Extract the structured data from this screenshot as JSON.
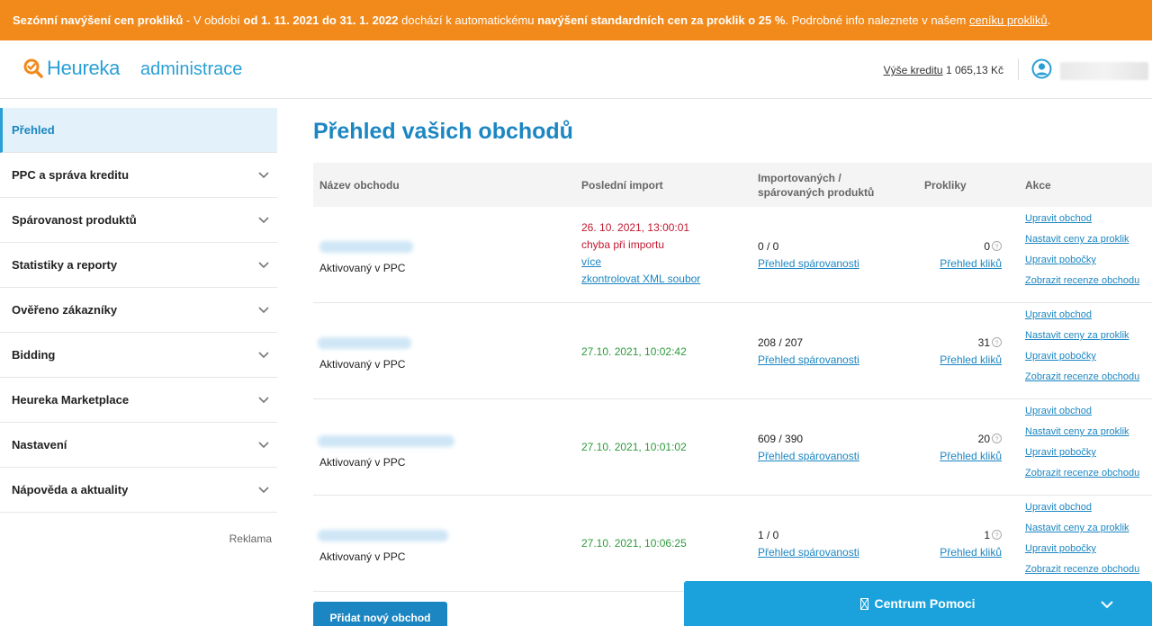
{
  "banner": {
    "part1": "Sezónní navýšení cen prokliků",
    "part2": " - V období ",
    "part3": "od 1. 11. 2021 do 31. 1. 2022",
    "part4": " dochází k automatickému ",
    "part5": "navýšení standardních cen za proklik o 25 %",
    "part6": ". Podrobné info naleznete v našem ",
    "link": "ceníku prokliků",
    "part7": "."
  },
  "header": {
    "logo_text": "Heureka",
    "admin_label": "administrace",
    "credit_link": "Výše kreditu",
    "credit_value": "1 065,13 Kč",
    "accent": "#2a9fd6",
    "banner_color": "#f18a1b"
  },
  "sidebar": {
    "items": [
      {
        "label": "Přehled",
        "active": true
      },
      {
        "label": "PPC a správa kreditu"
      },
      {
        "label": "Spárovanost produktů"
      },
      {
        "label": "Statistiky a reporty"
      },
      {
        "label": "Ověřeno zákazníky"
      },
      {
        "label": "Bidding"
      },
      {
        "label": "Heureka Marketplace"
      },
      {
        "label": "Nastavení"
      },
      {
        "label": "Nápověda a aktuality"
      }
    ],
    "reklama": "Reklama"
  },
  "main": {
    "title": "Přehled vašich obchodů",
    "columns": {
      "name": "Název obchodu",
      "last_import": "Poslední import",
      "products_l1": "Importovaných /",
      "products_l2": "spárovaných produktů",
      "clicks": "Prokliky",
      "actions": "Akce"
    },
    "rows": [
      {
        "status": "Aktivovaný v PPC",
        "import_date": "26. 10. 2021, 13:00:01",
        "import_error": "chyba při importu",
        "import_more": "více",
        "import_check": "zkontrolovat XML soubor",
        "products": "0 / 0",
        "products_link": "Přehled spárovanosti",
        "clicks": "0",
        "clicks_link": "Přehled kliků"
      },
      {
        "status": "Aktivovaný v PPC",
        "import_date": "27.10. 2021, 10:02:42",
        "products": "208 / 207",
        "products_link": "Přehled spárovanosti",
        "clicks": "31",
        "clicks_link": "Přehled kliků"
      },
      {
        "status": "Aktivovaný v PPC",
        "import_date": "27.10. 2021, 10:01:02",
        "products": "609 / 390",
        "products_link": "Přehled spárovanosti",
        "clicks": "20",
        "clicks_link": "Přehled kliků"
      },
      {
        "status": "Aktivovaný v PPC",
        "import_date": "27.10. 2021, 10:06:25",
        "products": "1 / 0",
        "products_link": "Přehled spárovanosti",
        "clicks": "1",
        "clicks_link": "Přehled kliků"
      }
    ],
    "actions": [
      "Upravit obchod",
      "Nastavit ceny za proklik",
      "Upravit pobočky",
      "Zobrazit recenze obchodu"
    ],
    "add_button": "Přidat nový obchod"
  },
  "help": {
    "label": "Centrum Pomoci",
    "icon": "help-icon",
    "color": "#1ba2dc"
  }
}
